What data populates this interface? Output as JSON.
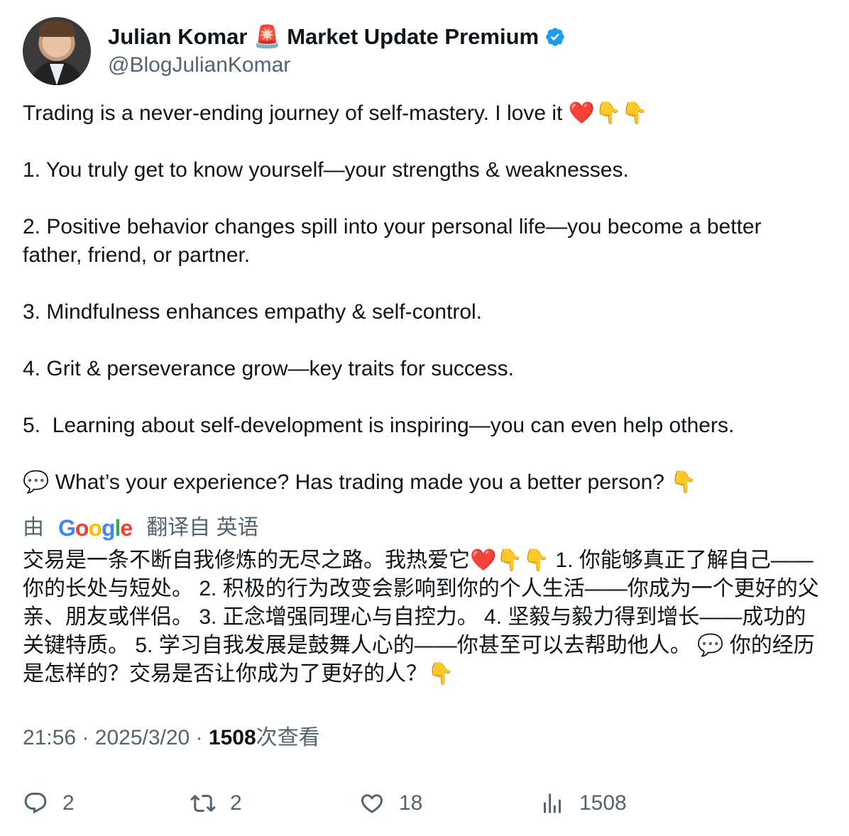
{
  "author": {
    "name": "Julian Komar 🚨 Market Update Premium",
    "handle": "@BlogJulianKomar"
  },
  "tweet": {
    "text": "Trading is a never-ending journey of self-mastery. I love it ❤️👇👇\n\n1. You truly get to know yourself—your strengths & weaknesses.\n\n2. Positive behavior changes spill into your personal life—you become a better father, friend, or partner.\n\n3. Mindfulness enhances empathy & self-control.\n\n4. Grit & perseverance grow—key traits for success.\n\n5.  Learning about self-development is inspiring—you can even help others.\n\n💬 What’s your experience? Has trading made you a better person? 👇",
    "translation_prefix": "由",
    "translation_provider": "Google",
    "translation_suffix": "翻译自 英语",
    "translated_text": "交易是一条不断自我修炼的无尽之路。我热爱它❤️👇👇 1. 你能够真正了解自己——你的长处与短处。 2. 积极的行为改变会影响到你的个人生活——你成为一个更好的父亲、朋友或伴侣。 3. 正念增强同理心与自控力。 4. 坚毅与毅力得到增长——成功的关键特质。 5. 学习自我发展是鼓舞人心的——你甚至可以去帮助他人。 💬 你的经历是怎样的？交易是否让你成为了更好的人？👇",
    "time": "21:56",
    "date": "2025/3/20",
    "separator": "·",
    "views_count": "1508",
    "views_label": "次查看"
  },
  "actions": {
    "reply_count": "2",
    "repost_count": "2",
    "like_count": "18",
    "views_count": "1508"
  },
  "colors": {
    "verified": "#1d9bf0",
    "secondary_text": "#536471",
    "primary_text": "#0f1419"
  },
  "icons": {
    "reply": "reply-icon",
    "repost": "repost-icon",
    "like": "heart-icon",
    "views": "views-icon",
    "verified": "verified-badge-icon"
  }
}
